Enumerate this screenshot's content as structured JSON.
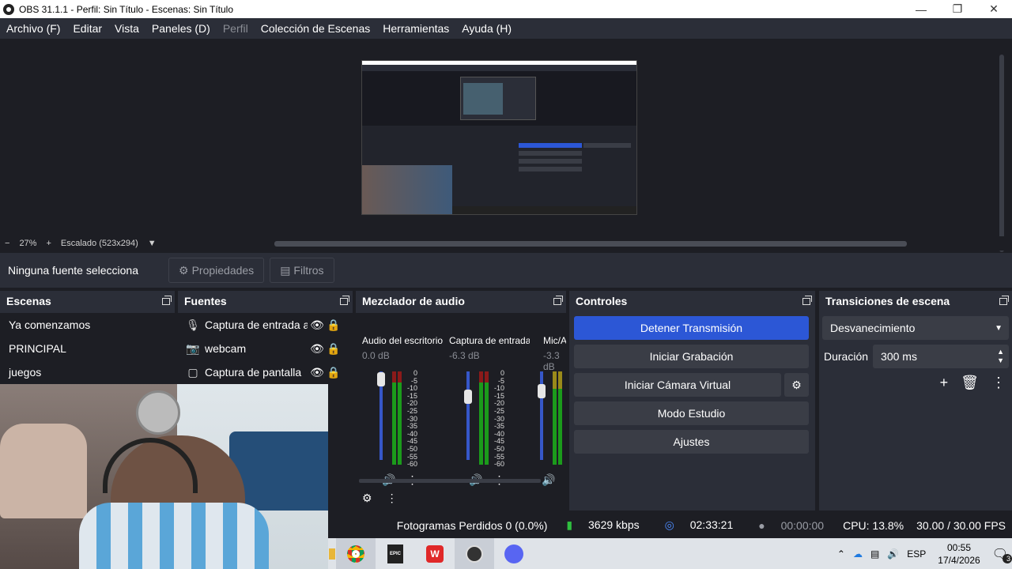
{
  "window": {
    "title": "OBS 31.1.1 - Perfil: Sin Título - Escenas: Sin Título"
  },
  "menu": [
    "Archivo (F)",
    "Editar",
    "Vista",
    "Paneles (D)",
    "Perfil",
    "Colección de Escenas",
    "Herramientas",
    "Ayuda (H)"
  ],
  "zoom": {
    "minus": "−",
    "level": "27%",
    "plus": "+",
    "mode": "Escalado (523x294)"
  },
  "propbar": {
    "no_selection": "Ninguna fuente selecciona",
    "properties": "Propiedades",
    "filters": "Filtros"
  },
  "scenes": {
    "title": "Escenas",
    "items": [
      "Ya comenzamos",
      "PRINCIPAL",
      "juegos"
    ]
  },
  "sources": {
    "title": "Fuentes",
    "items": [
      {
        "icon": "microphone-icon",
        "label": "Captura de entrada a"
      },
      {
        "icon": "camera-icon",
        "label": "webcam"
      },
      {
        "icon": "monitor-icon",
        "label": "Captura de pantalla"
      }
    ]
  },
  "mixer": {
    "title": "Mezclador de audio",
    "channels": [
      {
        "name": "Audio del escritorio",
        "db": "0.0 dB",
        "level": 0.97
      },
      {
        "name": "Captura de entrada",
        "db": "-6.3 dB",
        "level": 0.78
      },
      {
        "name": "Mic/Aux",
        "db": "-3.3 dB",
        "level": 0.84
      }
    ],
    "scale": [
      "0",
      "-5",
      "-10",
      "-15",
      "-20",
      "-25",
      "-30",
      "-35",
      "-40",
      "-45",
      "-50",
      "-55",
      "-60"
    ]
  },
  "controls": {
    "title": "Controles",
    "stop_stream": "Detener Transmisión",
    "start_record": "Iniciar Grabación",
    "virtual_cam": "Iniciar Cámara Virtual",
    "studio": "Modo Estudio",
    "settings": "Ajustes"
  },
  "transitions": {
    "title": "Transiciones de escena",
    "selected": "Desvanecimiento",
    "duration_label": "Duración",
    "duration_value": "300 ms"
  },
  "status": {
    "dropped": "Fotogramas Perdidos 0 (0.0%)",
    "bitrate": "3629 kbps",
    "stream_time": "02:33:21",
    "rec_time": "00:00:00",
    "cpu": "CPU: 13.8%",
    "fps": "30.00 / 30.00 FPS"
  },
  "taskbar": {
    "lang": "ESP",
    "time": "00:55",
    "date": "17/4/2026",
    "notif_count": "3",
    "epic_label": "EPIC"
  }
}
